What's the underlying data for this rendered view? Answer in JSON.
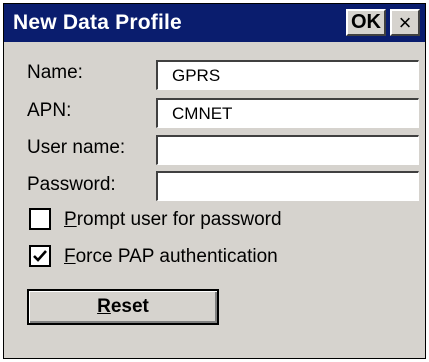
{
  "window": {
    "title": "New Data Profile",
    "ok_label": "OK",
    "close_label": "×"
  },
  "form": {
    "name_label": "Name:",
    "name_value": "GPRS",
    "apn_label": "APN:",
    "apn_value": "CMNET",
    "username_label": "User name:",
    "username_value": "",
    "password_label": "Password:",
    "password_value": ""
  },
  "options": {
    "prompt_first": "P",
    "prompt_rest": "rompt user for password",
    "prompt_checked": false,
    "pap_first": "F",
    "pap_rest": "orce PAP authentication",
    "pap_checked": true
  },
  "buttons": {
    "reset_first": "R",
    "reset_rest": "eset"
  },
  "colors": {
    "titlebar": "#0a1d6e",
    "face": "#d6d3ce"
  }
}
